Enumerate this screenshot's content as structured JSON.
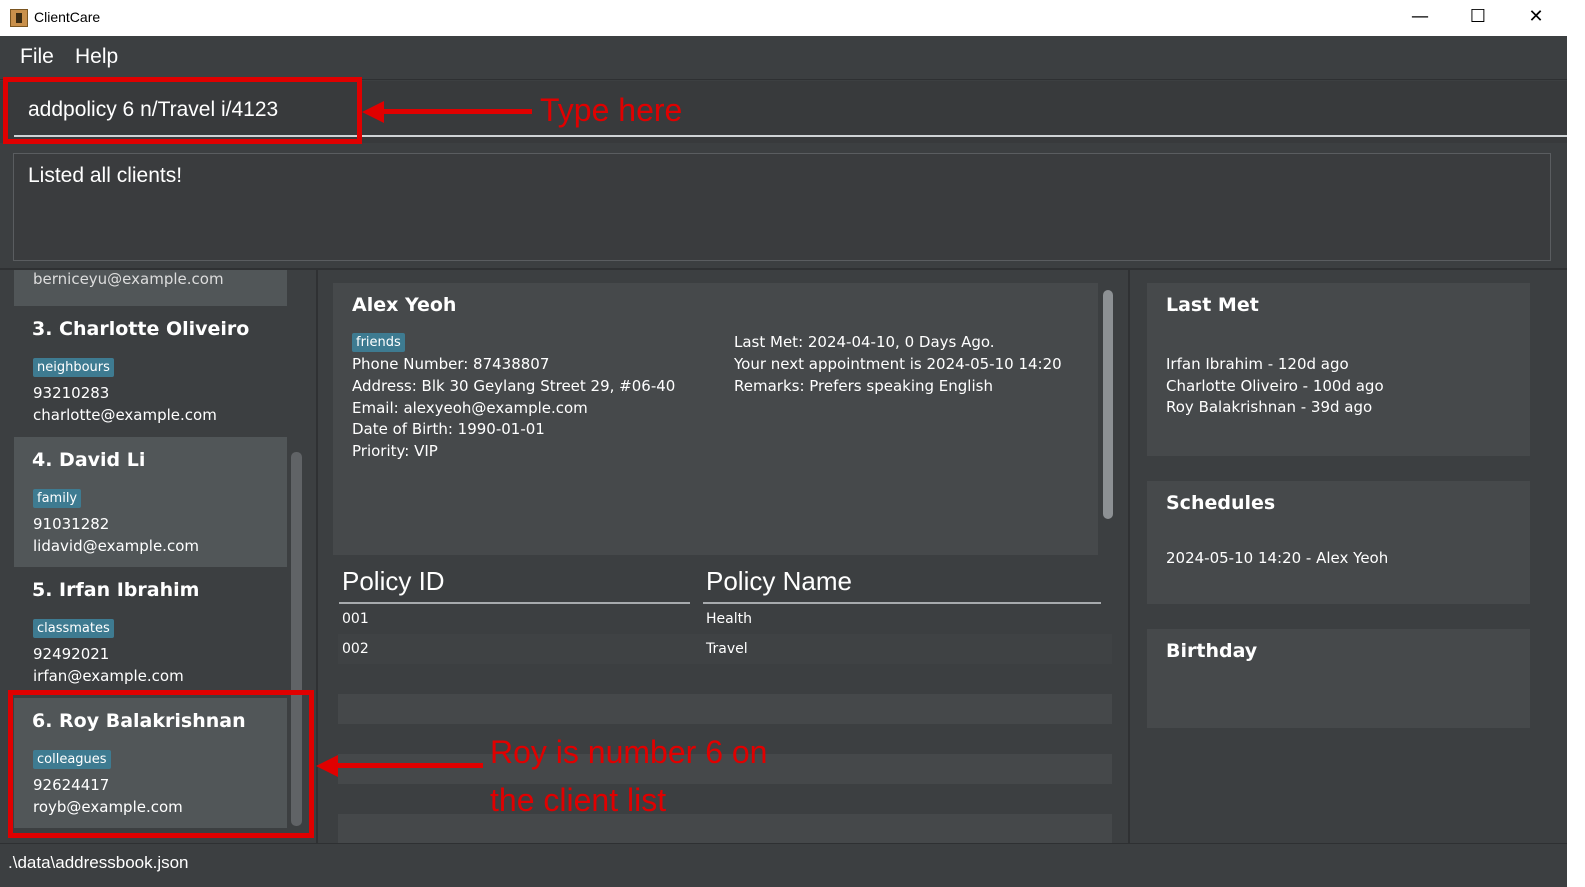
{
  "window": {
    "title": "ClientCare",
    "minimize_glyph": "—",
    "maximize_glyph": "☐",
    "close_glyph": "✕"
  },
  "menu": {
    "file": "File",
    "help": "Help"
  },
  "command": {
    "value": "addpolicy 6 n/Travel i/4123"
  },
  "result": {
    "text": "Listed all clients!"
  },
  "client_list": {
    "partial_email": "berniceyu@example.com",
    "cards": [
      {
        "index_name": "3.  Charlotte Oliveiro",
        "tag": "neighbours",
        "phone": "93210283",
        "email": "charlotte@example.com"
      },
      {
        "index_name": "4.  David Li",
        "tag": "family",
        "phone": "91031282",
        "email": "lidavid@example.com"
      },
      {
        "index_name": "5.  Irfan Ibrahim",
        "tag": "classmates",
        "phone": "92492021",
        "email": "irfan@example.com"
      },
      {
        "index_name": "6.  Roy Balakrishnan",
        "tag": "colleagues",
        "phone": "92624417",
        "email": "royb@example.com"
      }
    ]
  },
  "detail": {
    "name": "Alex Yeoh",
    "tag": "friends",
    "phone": "Phone Number: 87438807",
    "address": "Address: Blk 30 Geylang Street 29, #06-40",
    "email": "Email: alexyeoh@example.com",
    "dob": "Date of Birth: 1990-01-01",
    "priority": "Priority: VIP",
    "last_met": "Last Met: 2024-04-10, 0 Days Ago.",
    "next_appt": "Your next appointment is 2024-05-10 14:20",
    "remarks": "Remarks: Prefers speaking English"
  },
  "policies": {
    "header_id": "Policy ID",
    "header_name": "Policy Name",
    "rows": [
      {
        "id": "001",
        "name": "Health"
      },
      {
        "id": "002",
        "name": "Travel"
      }
    ]
  },
  "last_met": {
    "title": "Last Met",
    "items": [
      "Irfan Ibrahim - 120d ago",
      "Charlotte Oliveiro - 100d ago",
      "Roy Balakrishnan - 39d ago"
    ]
  },
  "schedules": {
    "title": "Schedules",
    "items": [
      "2024-05-10 14:20 - Alex Yeoh"
    ]
  },
  "birthday": {
    "title": "Birthday"
  },
  "status": {
    "path": ".\\data\\addressbook.json"
  },
  "annotations": {
    "type_here": "Type here",
    "roy_line1": "Roy is number 6 on",
    "roy_line2": "the client list",
    "color": "#e00000"
  },
  "colors": {
    "background": "#3c3f41",
    "tag": "#3e7b91",
    "selected_card": "#515658"
  }
}
